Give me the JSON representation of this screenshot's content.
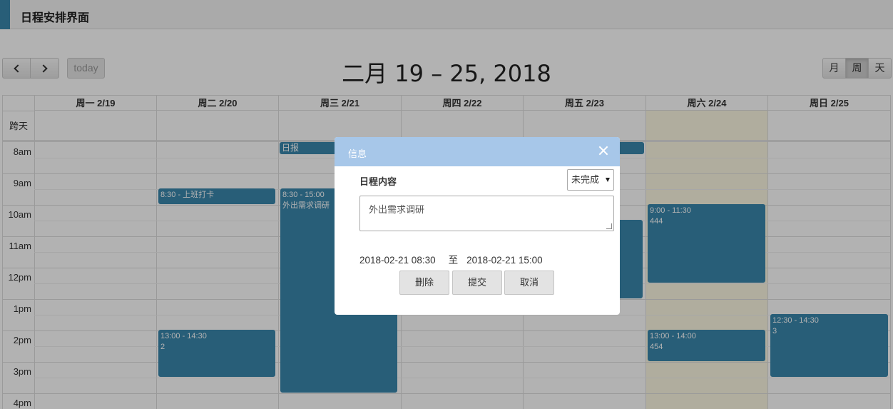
{
  "app": {
    "title": "日程安排界面",
    "accent_color": "#3a87ad"
  },
  "toolbar": {
    "prev_icon": "chevron-left-icon",
    "next_icon": "chevron-right-icon",
    "today_label": "today",
    "date_range": "二月 19 – 25, 2018",
    "views": {
      "month": "月",
      "week": "周",
      "day": "天"
    },
    "active_view": "周"
  },
  "calendar": {
    "allday_label": "跨天",
    "day_headers": [
      "周一 2/19",
      "周二 2/20",
      "周三 2/21",
      "周四 2/22",
      "周五 2/23",
      "周六 2/24",
      "周日 2/25"
    ],
    "time_labels": [
      "8am",
      "9am",
      "10am",
      "11am",
      "12pm",
      "1pm",
      "2pm",
      "3pm",
      "4pm"
    ],
    "today_column": "周六 2/24",
    "today_color": "#fcf8e3",
    "event_color": "#3a87ad",
    "allday_events": [
      {
        "title": "日报",
        "day": "周三 2/21",
        "end_day": "周五 2/23"
      }
    ],
    "events": [
      {
        "day": "周二 2/20",
        "time": "8:30 - 上班打卡",
        "title": ""
      },
      {
        "day": "周二 2/20",
        "time": "13:00 - 14:30",
        "title": "2"
      },
      {
        "day": "周三 2/21",
        "time": "8:30 - 15:00",
        "title": "外出需求调研"
      },
      {
        "day": "周五 2/23",
        "time": "",
        "title": ""
      },
      {
        "day": "周六 2/24",
        "time": "9:00 - 11:30",
        "title": "444"
      },
      {
        "day": "周六 2/24",
        "time": "13:00 - 14:00",
        "title": "454"
      },
      {
        "day": "周日 2/25",
        "time": "12:30 - 14:30",
        "title": "3"
      }
    ]
  },
  "modal": {
    "title": "信息",
    "close_icon": "close-icon",
    "content_label": "日程内容",
    "status_value": "未完成",
    "content_value": "外出需求调研",
    "start": "2018-02-21 08:30",
    "separator": "至",
    "end": "2018-02-21 15:00",
    "buttons": {
      "delete": "删除",
      "submit": "提交",
      "cancel": "取消"
    },
    "header_color": "#a7c7e9"
  }
}
